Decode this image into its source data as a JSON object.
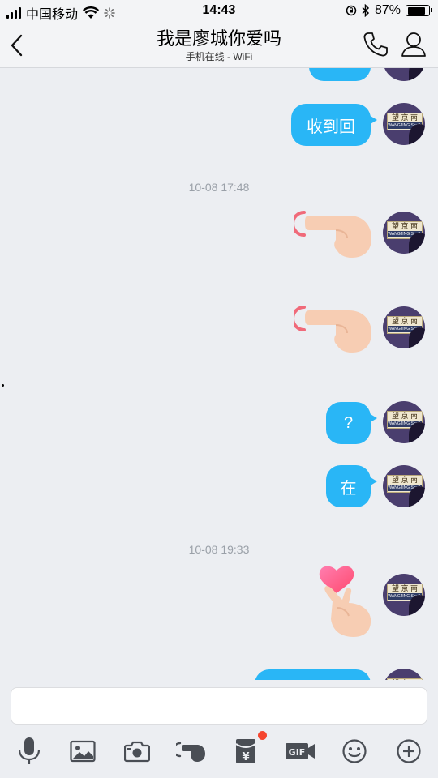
{
  "status_bar": {
    "carrier": "中国移动",
    "time": "14:43",
    "battery_percent": "87%",
    "battery_level": 0.87
  },
  "header": {
    "title": "我是廖城你爱吗",
    "subtitle": "手机在线 - WiFi"
  },
  "avatar_sign": {
    "line1": "望 京 南",
    "line2": "WANGJING South"
  },
  "messages": {
    "m2_text": "收到回",
    "time1": "10-08 17:48",
    "m5_text": "?",
    "m6_text": "在",
    "time2": "10-08 19:33"
  },
  "input": {
    "value": "",
    "placeholder": ""
  },
  "toolbar": {
    "icons": [
      "mic-icon",
      "image-icon",
      "camera-icon",
      "poke-icon",
      "red-packet-icon",
      "gif-icon",
      "emoji-icon",
      "plus-icon"
    ],
    "gif_label": "GIF",
    "red_packet_symbol": "¥"
  },
  "colors": {
    "bubble": "#29b6f6",
    "background": "#eceef2",
    "notification_dot": "#f5452f"
  }
}
